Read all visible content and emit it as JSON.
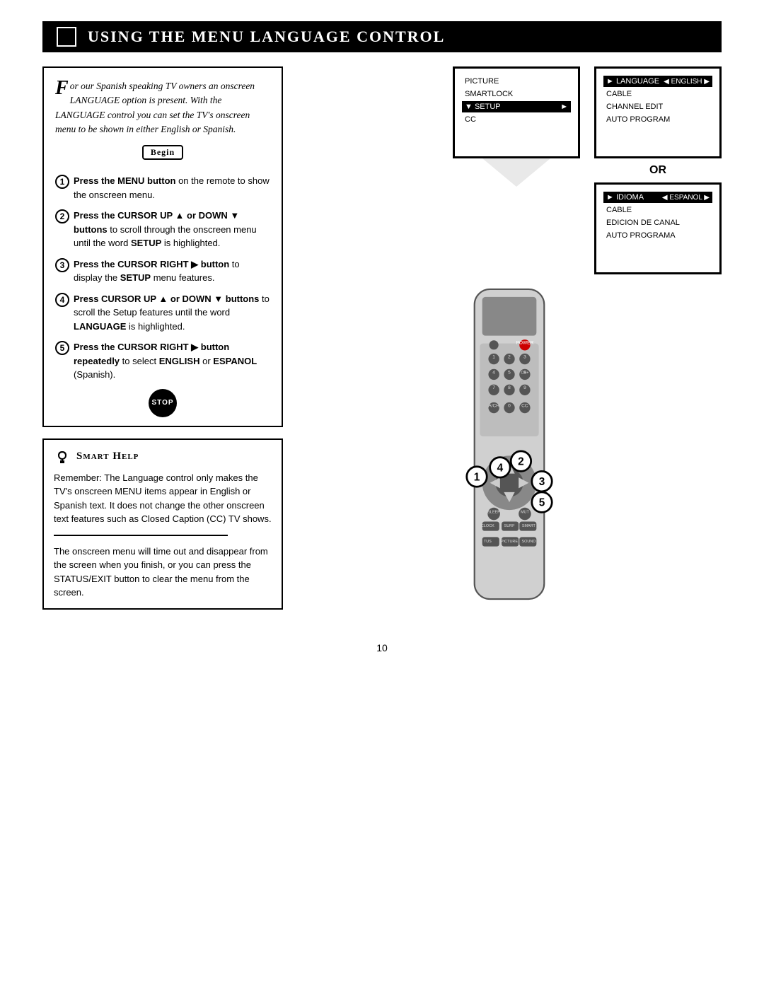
{
  "header": {
    "title": "Using the Menu Language Control",
    "icon_label": "tv-icon"
  },
  "intro": {
    "dropcap": "F",
    "text": "or our Spanish speaking TV owners an onscreen LANGUAGE option is present. With the LANGUAGE control you can set the TV's onscreen menu to be shown in either English or Spanish."
  },
  "begin_label": "Begin",
  "steps": [
    {
      "num": "1",
      "text": "Press the MENU button on the remote to show the onscreen menu."
    },
    {
      "num": "2",
      "text_parts": [
        {
          "bold": true,
          "text": "Press the CURSOR UP "
        },
        {
          "bold": false,
          "text": "s  or "
        },
        {
          "bold": true,
          "text": "DOWN t  buttons"
        },
        {
          "bold": false,
          "text": " to scroll through the onscreen menu until the word "
        },
        {
          "bold": true,
          "text": "SETUP"
        },
        {
          "bold": false,
          "text": " is highlighted."
        }
      ]
    },
    {
      "num": "3",
      "text_parts": [
        {
          "bold": true,
          "text": "Press the CURSOR RIGHT "
        },
        {
          "bold": false,
          "text": "' "
        },
        {
          "bold": true,
          "text": "button"
        },
        {
          "bold": false,
          "text": " to display the "
        },
        {
          "bold": true,
          "text": "SETUP"
        },
        {
          "bold": false,
          "text": " menu features."
        }
      ]
    },
    {
      "num": "4",
      "text_parts": [
        {
          "bold": true,
          "text": "Press CURSOR UP s  or "
        },
        {
          "bold": false,
          "text": ""
        },
        {
          "bold": true,
          "text": "DOWN t  buttons"
        },
        {
          "bold": false,
          "text": " to scroll the Setup features until the word "
        },
        {
          "bold": true,
          "text": "LANGUAGE"
        },
        {
          "bold": false,
          "text": " is highlighted."
        }
      ]
    },
    {
      "num": "5",
      "text_parts": [
        {
          "bold": true,
          "text": "Press the CURSOR RIGHT "
        },
        {
          "bold": false,
          "text": "' "
        },
        {
          "bold": true,
          "text": "button repeatedly"
        },
        {
          "bold": false,
          "text": " to select "
        },
        {
          "bold": true,
          "text": "ENGLISH"
        },
        {
          "bold": false,
          "text": " or "
        },
        {
          "bold": true,
          "text": "ESPANOL"
        },
        {
          "bold": false,
          "text": " (Spanish)."
        }
      ]
    }
  ],
  "stop_label": "STOP",
  "smart_help": {
    "title": "Smart Help",
    "text": "Remember: The Language control only makes the TV's onscreen MENU items appear in English or Spanish text. It does not change the other onscreen text features such as Closed Caption (CC) TV shows."
  },
  "bottom_text": "The onscreen menu will time out and disappear from the screen when you finish, or you can press the STATUS/EXIT button to clear the menu from the screen.",
  "tv_screen1": {
    "items": [
      "PICTURE",
      "SMARTLOCK",
      "SETUP",
      "CC"
    ],
    "highlighted": "SETUP",
    "has_arrow": true
  },
  "tv_screen2_english": {
    "items": [
      "LANGUAGE",
      "CABLE",
      "CHANNEL EDIT",
      "AUTO PROGRAM"
    ],
    "highlighted": "LANGUAGE",
    "value": "ENGLISH"
  },
  "or_label": "OR",
  "tv_screen3_espanol": {
    "items": [
      "IDIOMA",
      "CABLE",
      "EDICION DE CANAL",
      "AUTO PROGRAMA"
    ],
    "highlighted": "IDIOMA",
    "value": "ESPANOL"
  },
  "page_number": "10"
}
